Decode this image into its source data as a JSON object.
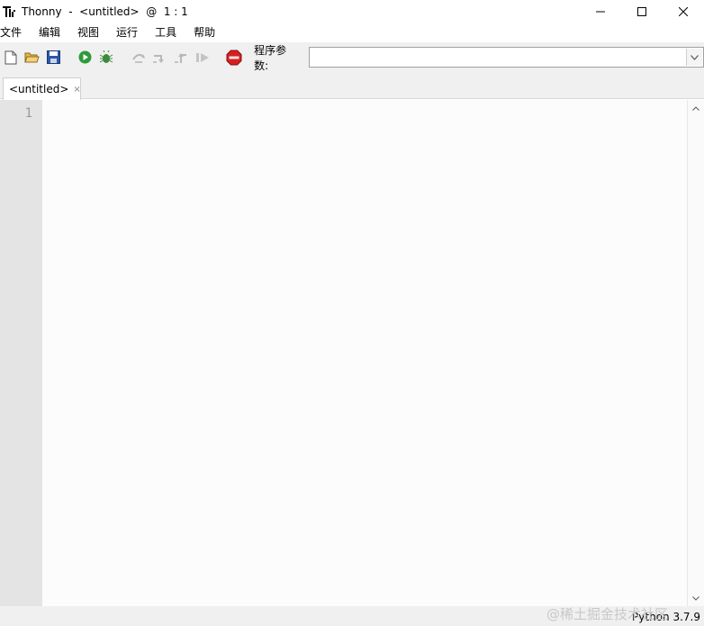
{
  "window": {
    "title": "Thonny  -  <untitled>  @  1 : 1",
    "logo_icon": "thonny-logo-icon",
    "controls": [
      "minimize-icon",
      "maximize-icon",
      "close-icon"
    ]
  },
  "menu": {
    "items": [
      {
        "label": "文件"
      },
      {
        "label": "编辑"
      },
      {
        "label": "视图"
      },
      {
        "label": "运行"
      },
      {
        "label": "工具"
      },
      {
        "label": "帮助"
      }
    ]
  },
  "toolbar": {
    "buttons": [
      {
        "icon": "new-file-icon"
      },
      {
        "icon": "open-folder-icon"
      },
      {
        "icon": "save-icon"
      },
      {
        "icon": "run-icon"
      },
      {
        "icon": "debug-icon"
      },
      {
        "icon": "step-over-icon"
      },
      {
        "icon": "step-into-icon"
      },
      {
        "icon": "step-out-icon"
      },
      {
        "icon": "resume-icon"
      },
      {
        "icon": "stop-icon"
      }
    ],
    "args_label": "程序参数:",
    "args_value": ""
  },
  "tabs": [
    {
      "label": "<untitled>",
      "close": "×"
    }
  ],
  "editor": {
    "line_numbers": [
      "1"
    ],
    "content": ""
  },
  "status": {
    "interpreter": "Python 3.7.9"
  },
  "watermark": "@稀土掘金技术社区",
  "colors": {
    "accent_run": "#2e9a3a",
    "stop": "#d42020",
    "gutter": "#e4e4e4",
    "toolbar_bg": "#f0f0f0"
  }
}
